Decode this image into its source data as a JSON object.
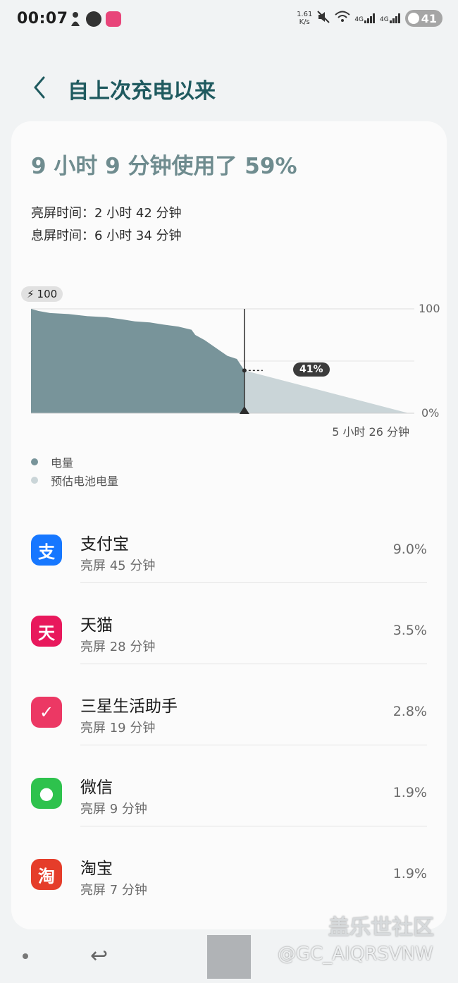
{
  "status_bar": {
    "time": "00:07",
    "net_speed_value": "1.61",
    "net_speed_unit": "K/s",
    "signal1": "4G",
    "signal2": "4G",
    "battery": "41"
  },
  "header": {
    "title": "自上次充电以来"
  },
  "summary": {
    "headline": "9 小时 9 分钟使用了 59%",
    "screen_on": "亮屏时间：2 小时 42 分钟",
    "screen_off": "息屏时间：6 小时 34 分钟"
  },
  "chart_data": {
    "type": "area",
    "start_label": "100",
    "y_top_label": "100",
    "y_bottom_label": "0%",
    "x_end_label": "5 小时 26 分钟",
    "current_label": "41%",
    "ylim": [
      0,
      100
    ],
    "series": [
      {
        "name": "电量",
        "points": [
          [
            0,
            100
          ],
          [
            4,
            98
          ],
          [
            10,
            96
          ],
          [
            20,
            95
          ],
          [
            30,
            93
          ],
          [
            40,
            92
          ],
          [
            48,
            90
          ],
          [
            55,
            88
          ],
          [
            63,
            87
          ],
          [
            70,
            85
          ],
          [
            78,
            83
          ],
          [
            85,
            80
          ],
          [
            87,
            75
          ],
          [
            92,
            70
          ],
          [
            100,
            60
          ],
          [
            104,
            55
          ],
          [
            109,
            52
          ],
          [
            113,
            41
          ]
        ]
      },
      {
        "name": "预估电池电量",
        "points": [
          [
            113,
            41
          ],
          [
            200,
            0
          ]
        ]
      }
    ],
    "colors": {
      "actual": "#78949a",
      "predicted": "#cad5d8"
    }
  },
  "legend": [
    {
      "label": "电量",
      "color": "#78949a"
    },
    {
      "label": "预估电池电量",
      "color": "#cad5d8"
    }
  ],
  "apps": [
    {
      "name": "支付宝",
      "usage": "亮屏 45 分钟",
      "percent": "9.0%",
      "icon": "alipay-icon",
      "icon_text": "支",
      "color": "#1677ff"
    },
    {
      "name": "天猫",
      "usage": "亮屏 28 分钟",
      "percent": "3.5%",
      "icon": "tmall-icon",
      "icon_text": "天",
      "color": "#e8185c"
    },
    {
      "name": "三星生活助手",
      "usage": "亮屏 19 分钟",
      "percent": "2.8%",
      "icon": "reminder-icon",
      "icon_text": "✓",
      "color": "#ec3864"
    },
    {
      "name": "微信",
      "usage": "亮屏 9 分钟",
      "percent": "1.9%",
      "icon": "wechat-icon",
      "icon_text": "●",
      "color": "#2ec24d"
    },
    {
      "name": "淘宝",
      "usage": "亮屏 7 分钟",
      "percent": "1.9%",
      "icon": "taobao-icon",
      "icon_text": "淘",
      "color": "#e53d2a"
    }
  ],
  "watermark": {
    "site": "盖乐世社区",
    "user": "@GC_AIQRSVNW"
  }
}
